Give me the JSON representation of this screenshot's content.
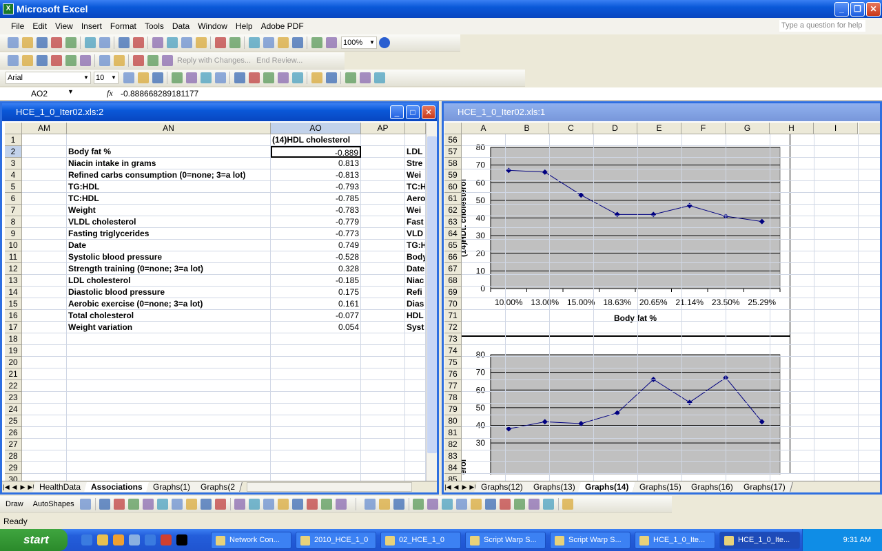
{
  "app": {
    "title": "Microsoft Excel",
    "help_placeholder": "Type a question for help"
  },
  "menu": [
    "File",
    "Edit",
    "View",
    "Insert",
    "Format",
    "Tools",
    "Data",
    "Window",
    "Help",
    "Adobe PDF"
  ],
  "toolbar_standard": {
    "icons": [
      "new-icon",
      "open-icon",
      "save-icon",
      "permission-icon",
      "email-icon",
      "|",
      "print-icon",
      "print-preview-icon",
      "|",
      "spelling-icon",
      "research-icon",
      "|",
      "cut-icon",
      "copy-icon",
      "paste-icon",
      "format-painter-icon",
      "|",
      "undo-icon",
      "redo-icon",
      "|",
      "hyperlink-icon",
      "autosum-icon",
      "sort-ascending-icon",
      "sort-descending-icon",
      "|",
      "chart-wizard-icon",
      "drawing-icon"
    ],
    "zoom": "100%"
  },
  "toolbar_reviewing": {
    "icons": [
      "new-comment-icon",
      "prev-comment-icon",
      "next-comment-icon",
      "show-comment-icon",
      "show-all-comments-icon",
      "delete-comment-icon",
      "|",
      "track-changes-icon",
      "reject-icon",
      "|",
      "accept-icon",
      "highlight-icon",
      "send-icon"
    ],
    "reply_label": "Reply with Changes...",
    "end_review_label": "End Review..."
  },
  "toolbar_formatting": {
    "font": "Arial",
    "size": "10",
    "icons": [
      "bold-icon",
      "italic-icon",
      "underline-icon",
      "|",
      "align-left-icon",
      "align-center-icon",
      "align-right-icon",
      "merge-center-icon",
      "|",
      "currency-icon",
      "percent-icon",
      "comma-icon",
      "increase-decimal-icon",
      "decrease-decimal-icon",
      "|",
      "decrease-indent-icon",
      "increase-indent-icon",
      "|",
      "borders-icon",
      "fill-color-icon",
      "font-color-icon"
    ],
    "fill_color": "#ffff00",
    "font_color": "#ff0000"
  },
  "formula_bar": {
    "name_box": "AO2",
    "fx": "fx",
    "value": "-0.888668289181177"
  },
  "left_window": {
    "title": "HCE_1_0_Iter02.xls:2",
    "columns": [
      "AM",
      "AN",
      "AO",
      "AP",
      ""
    ],
    "selected_column": "AO",
    "selected_cell": "AO2",
    "header_AO": "(14)HDL cholesterol",
    "rows": [
      {
        "an": "Body fat %",
        "ao": "-0.889",
        "ap": "LDL"
      },
      {
        "an": "Niacin intake in grams",
        "ao": "0.813",
        "ap": "Stre"
      },
      {
        "an": "Refined carbs consumption (0=none; 3=a lot)",
        "ao": "-0.813",
        "ap": "Wei"
      },
      {
        "an": "TG:HDL",
        "ao": "-0.793",
        "ap": "TC:H"
      },
      {
        "an": "TC:HDL",
        "ao": "-0.785",
        "ap": "Aero"
      },
      {
        "an": "Weight",
        "ao": "-0.783",
        "ap": "Wei"
      },
      {
        "an": "VLDL cholesterol",
        "ao": "-0.779",
        "ap": "Fast"
      },
      {
        "an": "Fasting triglycerides",
        "ao": "-0.773",
        "ap": "VLD"
      },
      {
        "an": "Date",
        "ao": "0.749",
        "ap": "TG:H"
      },
      {
        "an": "Systolic blood pressure",
        "ao": "-0.528",
        "ap": "Body"
      },
      {
        "an": "Strength training (0=none; 3=a lot)",
        "ao": "0.328",
        "ap": "Date"
      },
      {
        "an": "LDL cholesterol",
        "ao": "-0.185",
        "ap": "Niac"
      },
      {
        "an": "Diastolic blood pressure",
        "ao": "0.175",
        "ap": "Refi"
      },
      {
        "an": "Aerobic exercise (0=none; 3=a lot)",
        "ao": "0.161",
        "ap": "Dias"
      },
      {
        "an": "Total cholesterol",
        "ao": "-0.077",
        "ap": "HDL"
      },
      {
        "an": "Weight variation",
        "ao": "0.054",
        "ap": "Syst"
      }
    ],
    "first_row": 1,
    "last_row": 30,
    "tabs": [
      "HealthData",
      "Associations",
      "Graphs(1)",
      "Graphs(2"
    ],
    "active_tab": "Associations"
  },
  "right_window": {
    "title": "HCE_1_0_Iter02.xls:1",
    "columns": [
      "A",
      "B",
      "C",
      "D",
      "E",
      "F",
      "G",
      "H",
      "I"
    ],
    "first_row": 56,
    "last_row": 85,
    "tabs": [
      "Graphs(12)",
      "Graphs(13)",
      "Graphs(14)",
      "Graphs(15)",
      "Graphs(16)",
      "Graphs(17)"
    ],
    "active_tab": "Graphs(14)"
  },
  "chart_data": [
    {
      "type": "line",
      "categories": [
        "10.00%",
        "13.00%",
        "15.00%",
        "18.63%",
        "20.65%",
        "21.14%",
        "23.50%",
        "25.29%"
      ],
      "values": [
        67,
        66,
        53,
        42,
        42,
        47,
        41,
        38
      ],
      "xlabel": "Body fat %",
      "ylabel": "(14)HDL cholesterol",
      "ylim": [
        0,
        80
      ],
      "yticks": [
        0,
        10,
        20,
        30,
        40,
        50,
        60,
        70,
        80
      ],
      "grid": true,
      "plot_bg": "#c0c0c0",
      "line_color": "#000080"
    },
    {
      "type": "line",
      "values": [
        38,
        42,
        41,
        47,
        66,
        53,
        67,
        42
      ],
      "ylabel": "DL cholesterol",
      "ylim": [
        0,
        80
      ],
      "yticks": [
        30,
        40,
        50,
        60,
        70,
        80
      ],
      "grid": true,
      "plot_bg": "#c0c0c0",
      "line_color": "#000080"
    }
  ],
  "drawing_toolbar": {
    "draw_label": "Draw",
    "autoshapes_label": "AutoShapes",
    "icons": [
      "select-objects-icon",
      "|",
      "line-icon",
      "arrow-icon",
      "rectangle-icon",
      "oval-icon",
      "textbox-icon",
      "wordart-icon",
      "diagram-icon",
      "clipart-icon",
      "picture-icon",
      "|",
      "fill-color-icon",
      "line-color-icon",
      "font-color-icon",
      "line-style-icon",
      "dash-style-icon",
      "arrow-style-icon",
      "shadow-icon",
      "3d-icon"
    ],
    "forms_icons": [
      "edit-icon",
      "properties-icon",
      "view-code-icon",
      "|",
      "checkbox-icon",
      "textfield-icon",
      "button-icon",
      "option-icon",
      "listbox-icon",
      "combobox-icon",
      "scrollbar-icon",
      "spinner-icon",
      "label-icon",
      "image-icon",
      "|",
      "tools-icon"
    ]
  },
  "status": {
    "text": "Ready"
  },
  "taskbar": {
    "start": "start",
    "quick_launch": [
      "ie-icon",
      "folder-icon",
      "clock-icon",
      "notepad-icon",
      "ie2-icon",
      "chrome-icon",
      "cmd-icon"
    ],
    "tasks": [
      {
        "label": "Network Con..."
      },
      {
        "label": "2010_HCE_1_0"
      },
      {
        "label": "02_HCE_1_0"
      },
      {
        "label": "Script Warp S..."
      },
      {
        "label": "Script Warp S..."
      },
      {
        "label": "HCE_1_0_Ite..."
      },
      {
        "label": "HCE_1_0_Ite...",
        "active": true
      }
    ],
    "clock": "9:31 AM"
  }
}
